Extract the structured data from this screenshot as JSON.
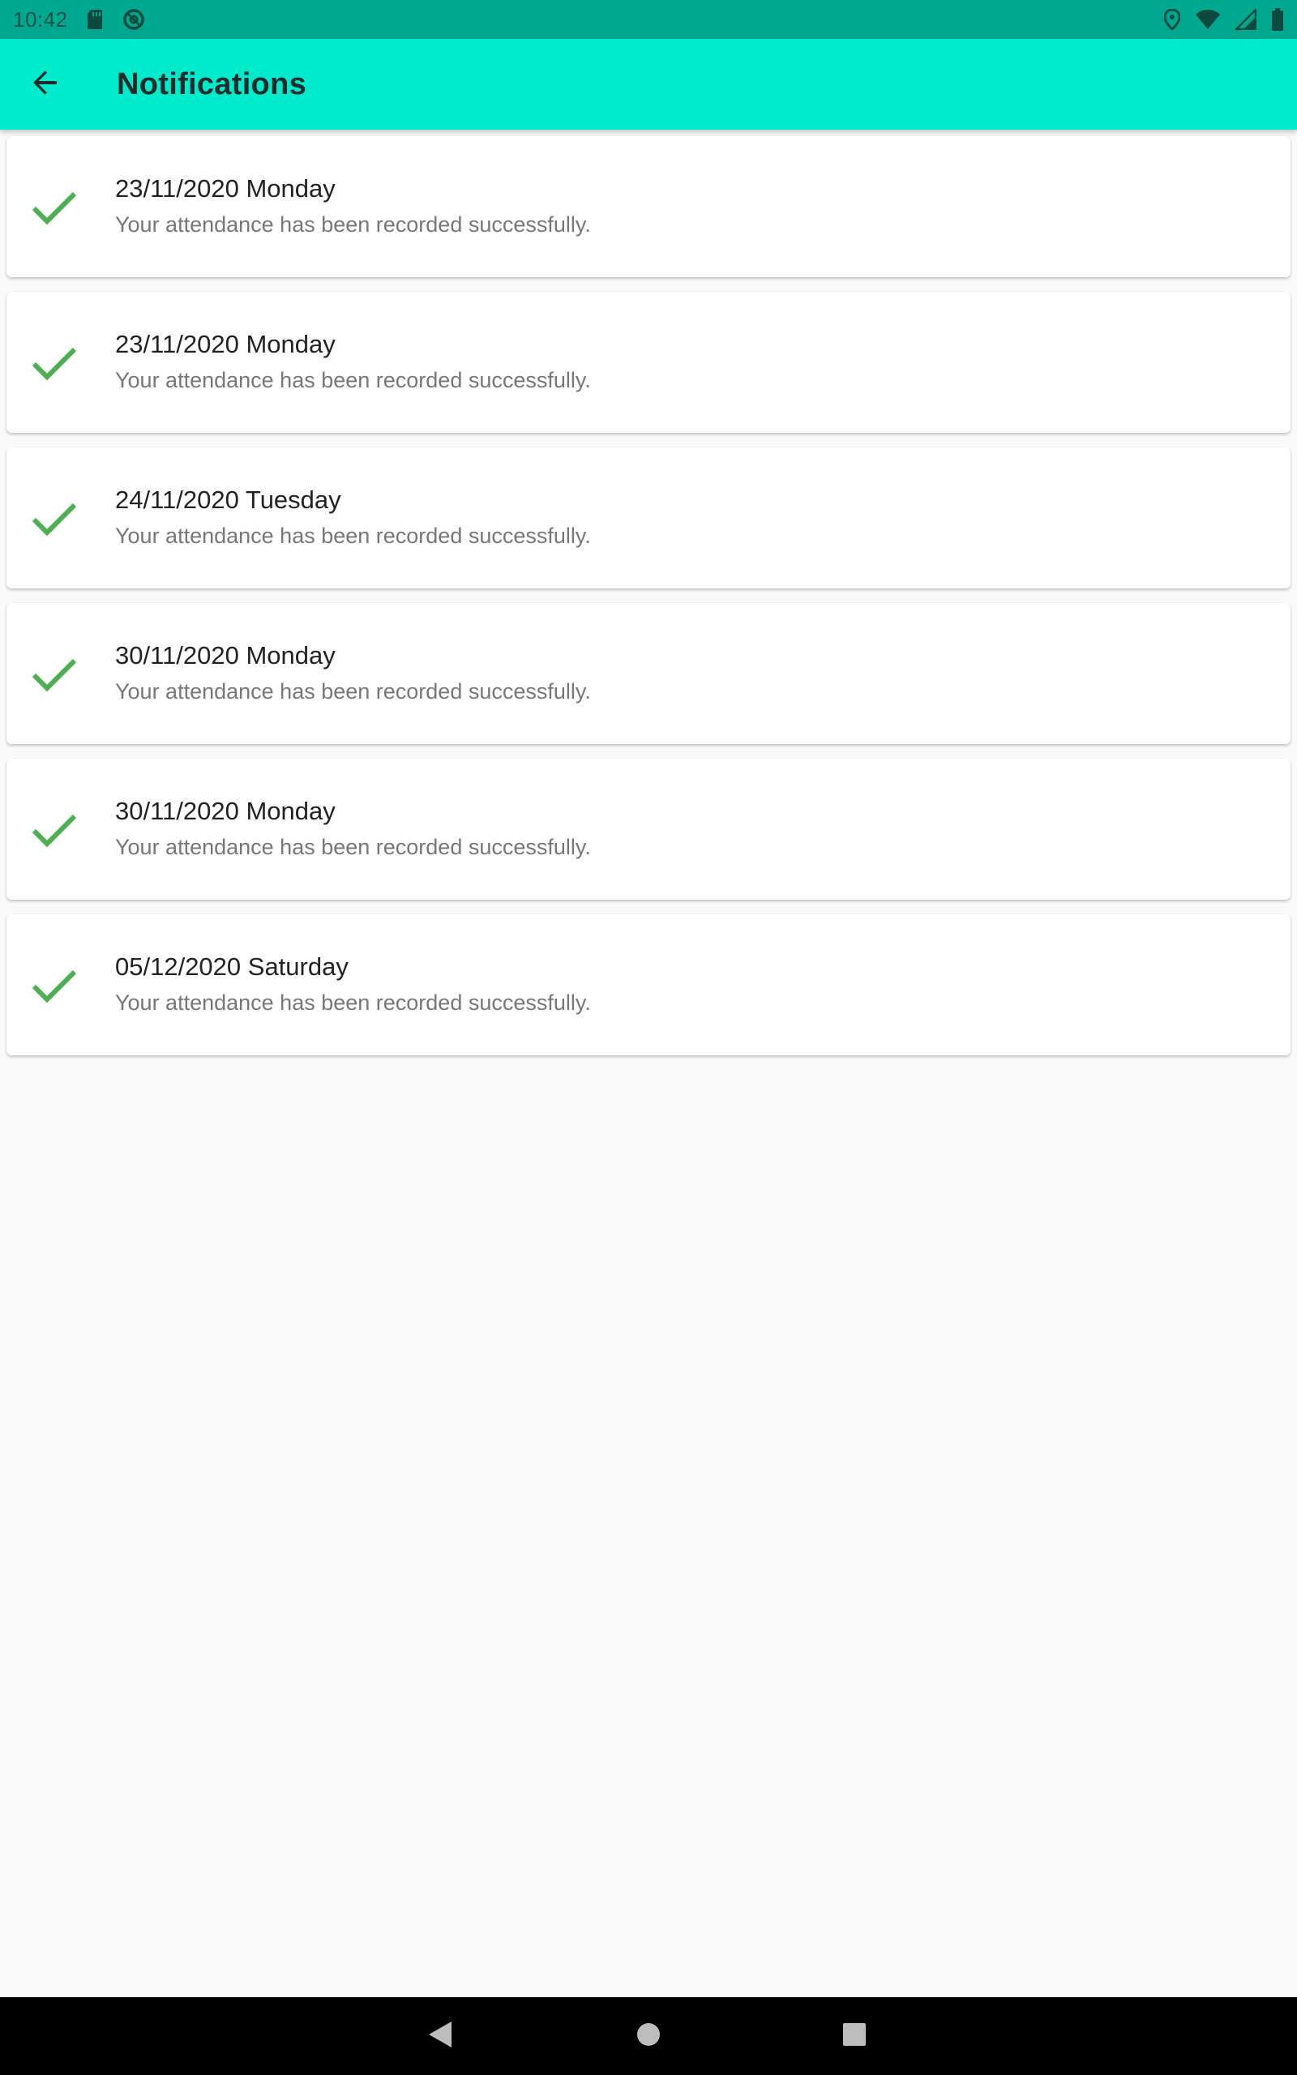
{
  "status_bar": {
    "time": "10:42",
    "left_icons": [
      "sd-card-icon",
      "data-saver-icon"
    ],
    "right_icons": [
      "location-icon",
      "wifi-icon",
      "signal-icon",
      "battery-icon"
    ]
  },
  "app_bar": {
    "title": "Notifications",
    "back_icon": "arrow-back-icon",
    "background": "#00ebcb"
  },
  "notifications": [
    {
      "title": "23/11/2020 Monday",
      "message": "Your attendance has been recorded successfully.",
      "icon": "check-icon"
    },
    {
      "title": "23/11/2020 Monday",
      "message": "Your attendance has been recorded successfully.",
      "icon": "check-icon"
    },
    {
      "title": "24/11/2020 Tuesday",
      "message": "Your attendance has been recorded successfully.",
      "icon": "check-icon"
    },
    {
      "title": "30/11/2020 Monday",
      "message": "Your attendance has been recorded successfully.",
      "icon": "check-icon"
    },
    {
      "title": "30/11/2020 Monday",
      "message": "Your attendance has been recorded successfully.",
      "icon": "check-icon"
    },
    {
      "title": "05/12/2020 Saturday",
      "message": "Your attendance has been recorded successfully.",
      "icon": "check-icon"
    }
  ],
  "colors": {
    "status_bar": "#00a88f",
    "accent": "#00ebcb",
    "check": "#4caf50",
    "background": "#fafafa"
  },
  "nav_bar": {
    "buttons": [
      "back-nav-icon",
      "home-nav-icon",
      "recents-nav-icon"
    ]
  }
}
